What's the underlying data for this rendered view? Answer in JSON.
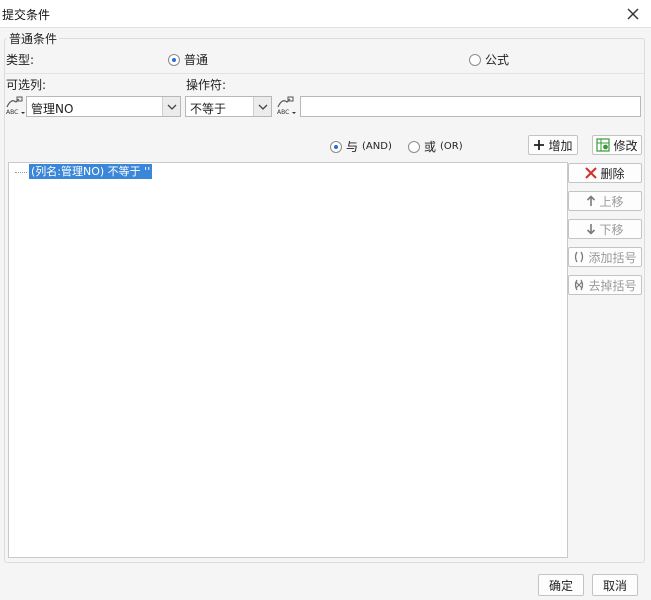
{
  "window": {
    "title": "提交条件"
  },
  "group": {
    "title": "普通条件"
  },
  "type_row": {
    "label": "类型:",
    "options": [
      "普通",
      "公式"
    ],
    "selected": "普通"
  },
  "column": {
    "label": "可选列:",
    "value": "管理NO"
  },
  "operator": {
    "label": "操作符:",
    "value": "不等于"
  },
  "value_input": {
    "value": "",
    "placeholder": ""
  },
  "logic": {
    "and_label": "与",
    "and_code": "(AND)",
    "or_label": "或",
    "or_code": "(OR)",
    "selected": "and"
  },
  "toolbar": {
    "add_label": "增加",
    "modify_label": "修改"
  },
  "conditions": [
    {
      "text": "(列名:管理NO) 不等于 ''"
    }
  ],
  "side_buttons": {
    "delete": "删除",
    "move_up": "上移",
    "move_down": "下移",
    "add_bracket": "添加括号",
    "remove_bracket": "去掉括号"
  },
  "footer": {
    "ok": "确定",
    "cancel": "取消"
  },
  "colors": {
    "selection": "#3a86d8",
    "radio_dot": "#2b6fd6",
    "delete_x": "#d62c2c"
  }
}
